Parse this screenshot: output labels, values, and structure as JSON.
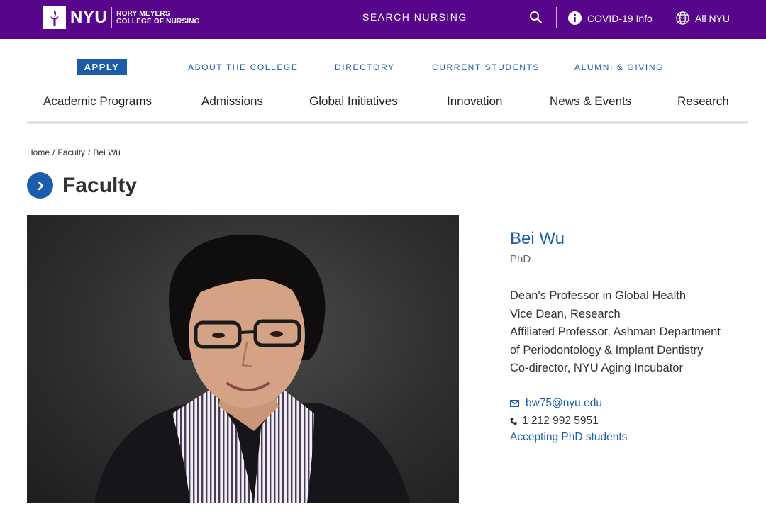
{
  "header": {
    "brand": "NYU",
    "school_line1": "RORY MEYERS",
    "school_line2": "COLLEGE OF NURSING",
    "search_placeholder": "SEARCH NURSING",
    "covid_link": "COVID-19 Info",
    "all_nyu_link": "All NYU",
    "colors": {
      "brand_purple": "#57068c",
      "link_blue": "#1c5dab"
    }
  },
  "utility_nav": {
    "apply": "APPLY",
    "items": [
      "ABOUT THE COLLEGE",
      "DIRECTORY",
      "CURRENT STUDENTS",
      "ALUMNI & GIVING"
    ]
  },
  "main_nav": {
    "items": [
      "Academic Programs",
      "Admissions",
      "Global Initiatives",
      "Innovation",
      "News & Events",
      "Research"
    ]
  },
  "breadcrumb": [
    "Home",
    "Faculty",
    "Bei Wu"
  ],
  "page_title": "Faculty",
  "profile": {
    "name": "Bei Wu",
    "degree": "PhD",
    "titles": [
      "Dean's Professor in Global Health",
      "Vice Dean, Research",
      "Affiliated Professor, Ashman Department",
      "of Periodontology & Implant Dentistry",
      "Co-director, NYU Aging Incubator"
    ],
    "email": "bw75@nyu.edu",
    "phone": "1 212 992 5951",
    "note": "Accepting PhD students"
  },
  "icons": [
    "nyu-torch-icon",
    "search-icon",
    "info-icon",
    "globe-icon",
    "chevron-right-icon",
    "mail-icon",
    "phone-icon"
  ]
}
